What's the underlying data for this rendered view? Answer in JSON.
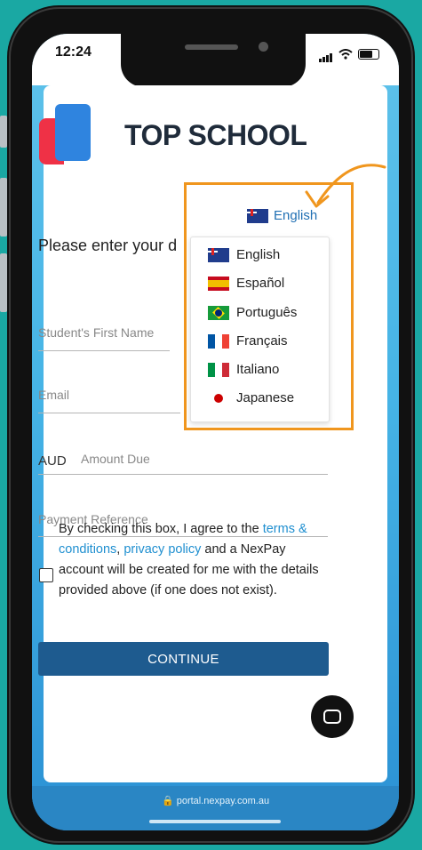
{
  "status": {
    "time": "12:24"
  },
  "brand": {
    "name": "TOP SCHOOL"
  },
  "form": {
    "prompt": "Please enter your d",
    "first_name_placeholder": "Student's First Name",
    "email_placeholder": "Email",
    "currency": "AUD",
    "amount_placeholder": "Amount Due",
    "reference_placeholder": "Payment Reference",
    "terms": {
      "text1": "By checking this box, I agree to the ",
      "link_terms": "terms & conditions",
      "sep": ", ",
      "link_privacy": "privacy policy",
      "text2": " and a NexPay account will be created for me with the details provided above (if one does not exist)."
    },
    "continue_label": "CONTINUE"
  },
  "language": {
    "selected": "English",
    "options": [
      "English",
      "Español",
      "Português",
      "Français",
      "Italiano",
      "Japanese"
    ],
    "option_icons": [
      "australia-flag-icon",
      "spain-flag-icon",
      "brazil-flag-icon",
      "france-flag-icon",
      "italy-flag-icon",
      "japan-flag-icon"
    ]
  },
  "browser": {
    "url": "portal.nexpay.com.au"
  },
  "colors": {
    "background": "#1aa8a3",
    "highlight": "#f0961e",
    "button": "#1e5b8f",
    "link": "#1f8fd0"
  }
}
